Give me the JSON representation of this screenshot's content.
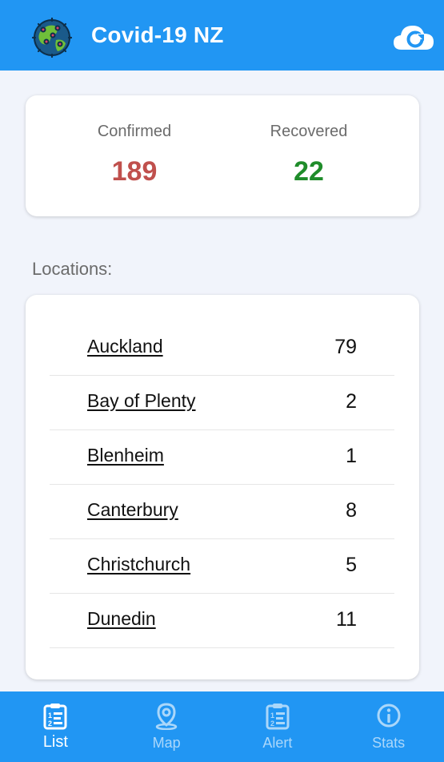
{
  "header": {
    "title": "Covid-19 NZ",
    "logo_icon": "virus-globe-icon",
    "refresh_icon": "cloud-refresh-icon",
    "color": "#2196f3"
  },
  "summary": {
    "confirmed_label": "Confirmed",
    "confirmed_value": "189",
    "confirmed_color": "#c0504d",
    "recovered_label": "Recovered",
    "recovered_value": "22",
    "recovered_color": "#1f8c2a"
  },
  "locations": {
    "heading": "Locations:",
    "items": [
      {
        "name": "Auckland",
        "count": "79"
      },
      {
        "name": "Bay of Plenty",
        "count": "2"
      },
      {
        "name": "Blenheim",
        "count": "1"
      },
      {
        "name": "Canterbury",
        "count": "8"
      },
      {
        "name": "Christchurch",
        "count": "5"
      },
      {
        "name": "Dunedin",
        "count": "11"
      }
    ]
  },
  "nav": {
    "items": [
      {
        "label": "List",
        "icon": "list-clipboard-icon",
        "active": true
      },
      {
        "label": "Map",
        "icon": "map-pin-icon",
        "active": false
      },
      {
        "label": "Alert",
        "icon": "alert-clipboard-icon",
        "active": false
      },
      {
        "label": "Stats",
        "icon": "info-circle-icon",
        "active": false
      }
    ]
  }
}
